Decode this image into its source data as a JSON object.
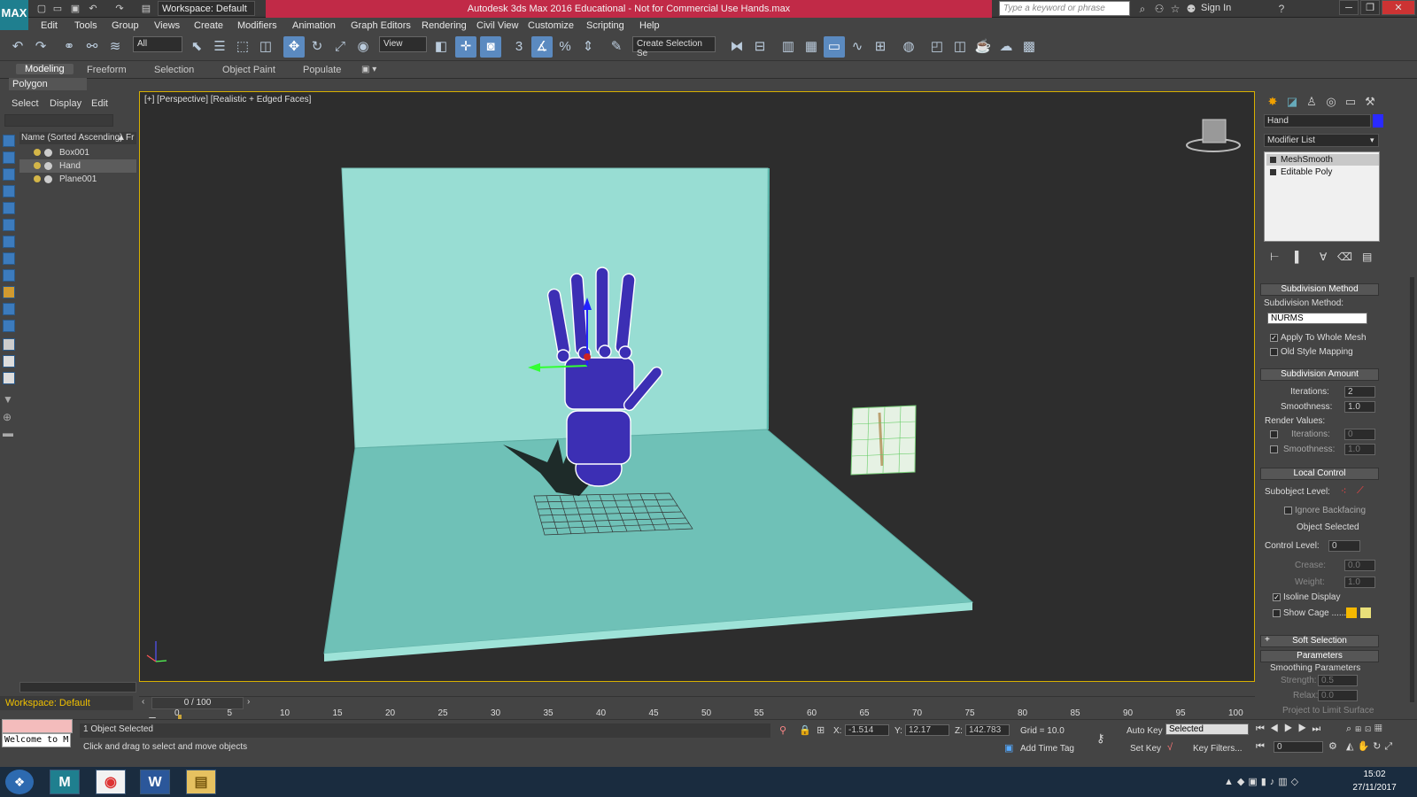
{
  "titlebar": {
    "workspace_label": "Workspace: Default",
    "title": "Autodesk 3ds Max 2016 Educational - Not for Commercial Use    Hands.max",
    "search_placeholder": "Type a keyword or phrase",
    "sign_in": "Sign In",
    "app_logo_text": "MAX"
  },
  "menu": [
    "Edit",
    "Tools",
    "Group",
    "Views",
    "Create",
    "Modifiers",
    "Animation",
    "Graph Editors",
    "Rendering",
    "Civil View",
    "Customize",
    "Scripting",
    "Help"
  ],
  "toolbar": {
    "selection_filter": "All",
    "ref_coord": "View",
    "named_selection": "Create Selection Se"
  },
  "ribbon": {
    "tabs": [
      "Modeling",
      "Freeform",
      "Selection",
      "Object Paint",
      "Populate"
    ],
    "active_tab": "Modeling",
    "panel_label": "Polygon Modeling"
  },
  "scene_explorer": {
    "menus": [
      "Select",
      "Display",
      "Edit"
    ],
    "column_header": "Name (Sorted Ascending)",
    "column_header_2": "Fr",
    "objects": [
      "Box001",
      "Hand",
      "Plane001"
    ],
    "selected": "Hand"
  },
  "viewport": {
    "label": "[+] [Perspective] [Realistic + Edged Faces]",
    "colors": {
      "plane": "#8fd9cf",
      "hand": "#3d2fb3",
      "bg": "#2d2d2d"
    }
  },
  "command_panel": {
    "object_name": "Hand",
    "object_color": "#2a2aff",
    "modifier_list": "Modifier List",
    "stack": [
      "MeshSmooth",
      "Editable Poly"
    ],
    "rollouts": {
      "subdivision_method": {
        "title": "Subdivision Method",
        "label": "Subdivision Method:",
        "value": "NURMS",
        "apply_whole_mesh": "Apply To Whole Mesh",
        "apply_whole_mesh_checked": true,
        "old_style": "Old Style Mapping",
        "old_style_checked": false
      },
      "subdivision_amount": {
        "title": "Subdivision Amount",
        "iterations_label": "Iterations:",
        "iterations": "2",
        "smoothness_label": "Smoothness:",
        "smoothness": "1.0",
        "render_values": "Render Values:",
        "r_iterations_label": "Iterations:",
        "r_iterations": "0",
        "r_smoothness_label": "Smoothness:",
        "r_smoothness": "1.0"
      },
      "local_control": {
        "title": "Local Control",
        "subobject_level": "Subobject Level:",
        "ignore_backfacing": "Ignore Backfacing",
        "object_selected": "Object Selected",
        "control_level_label": "Control Level:",
        "control_level": "0",
        "crease_label": "Crease:",
        "crease": "0.0",
        "weight_label": "Weight:",
        "weight": "1.0",
        "isoline": "Isoline Display",
        "isoline_checked": true,
        "show_cage": "Show Cage ......",
        "show_cage_checked": false
      },
      "soft_selection": {
        "title": "Soft Selection"
      },
      "parameters": {
        "title": "Parameters",
        "smoothing_params": "Smoothing Parameters",
        "strength_label": "Strength:",
        "strength": "0.5",
        "relax_label": "Relax:",
        "relax": "0.0",
        "project": "Project to Limit Surface"
      }
    }
  },
  "timeline": {
    "slider": "0 / 100",
    "ticks": [
      "0",
      "5",
      "10",
      "15",
      "20",
      "25",
      "30",
      "35",
      "40",
      "45",
      "50",
      "55",
      "60",
      "65",
      "70",
      "75",
      "80",
      "85",
      "90",
      "95",
      "100"
    ],
    "frame_fraction": 0.0
  },
  "status": {
    "selection": "1 Object Selected",
    "prompt": "Click and drag to select and move objects",
    "x_label": "X:",
    "x": "-1.514",
    "y_label": "Y:",
    "y": "12.17",
    "z_label": "Z:",
    "z": "142.783",
    "grid": "Grid = 10.0",
    "auto_key": "Auto Key",
    "key_mode": "Selected",
    "set_key": "Set Key",
    "key_filters": "Key Filters...",
    "add_time_tag": "Add Time Tag",
    "frame": "0",
    "maxscript": "Welcome to M",
    "workspace": "Workspace: Default"
  },
  "taskbar": {
    "time": "15:02",
    "date": "27/11/2017",
    "apps": [
      "windows-start",
      "3ds-max",
      "chrome",
      "word",
      "file-explorer"
    ]
  }
}
